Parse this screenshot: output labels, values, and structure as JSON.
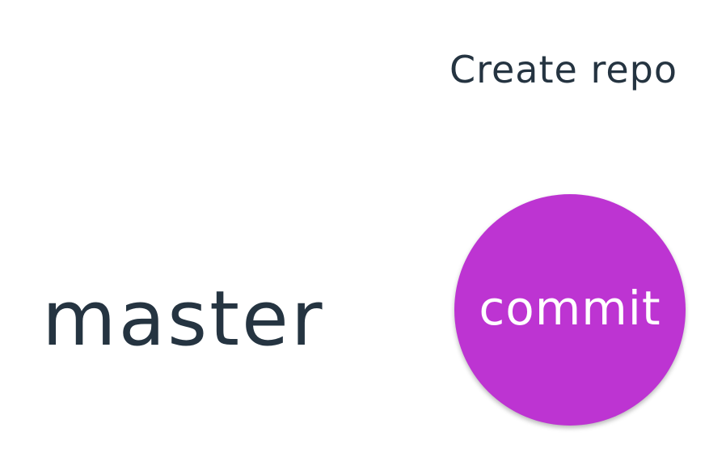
{
  "header": {
    "action_label": "Create repo"
  },
  "graph": {
    "branch_label": "master",
    "commit_label": "commit",
    "commit_color": "#bd34d2",
    "text_color": "#253441"
  }
}
